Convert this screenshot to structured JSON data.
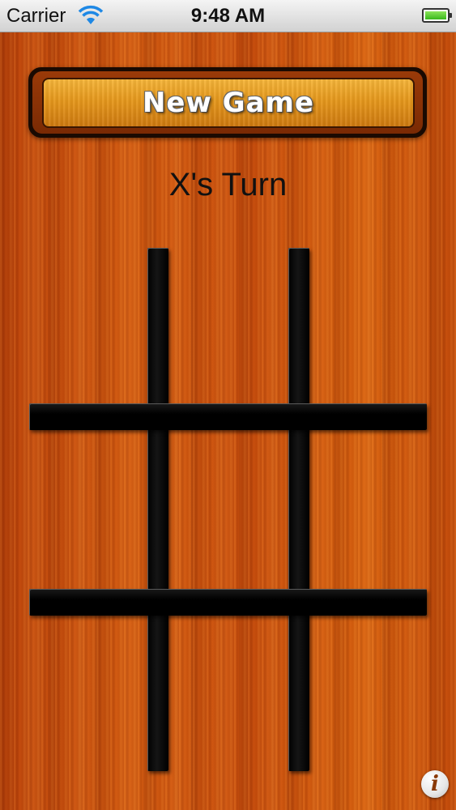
{
  "status_bar": {
    "carrier": "Carrier",
    "time": "9:48 AM",
    "wifi_icon": "wifi-icon",
    "battery_icon": "battery-icon",
    "battery_level": 1.0
  },
  "toolbar": {
    "new_game_label": "New Game"
  },
  "game": {
    "turn_text": "X's Turn",
    "board": [
      "",
      "",
      "",
      "",
      "",
      "",
      "",
      "",
      ""
    ]
  },
  "info": {
    "icon": "info-icon",
    "glyph": "i"
  },
  "colors": {
    "wood": "#c24a0a",
    "button_gold": "#e6981c",
    "grid": "#000000"
  }
}
